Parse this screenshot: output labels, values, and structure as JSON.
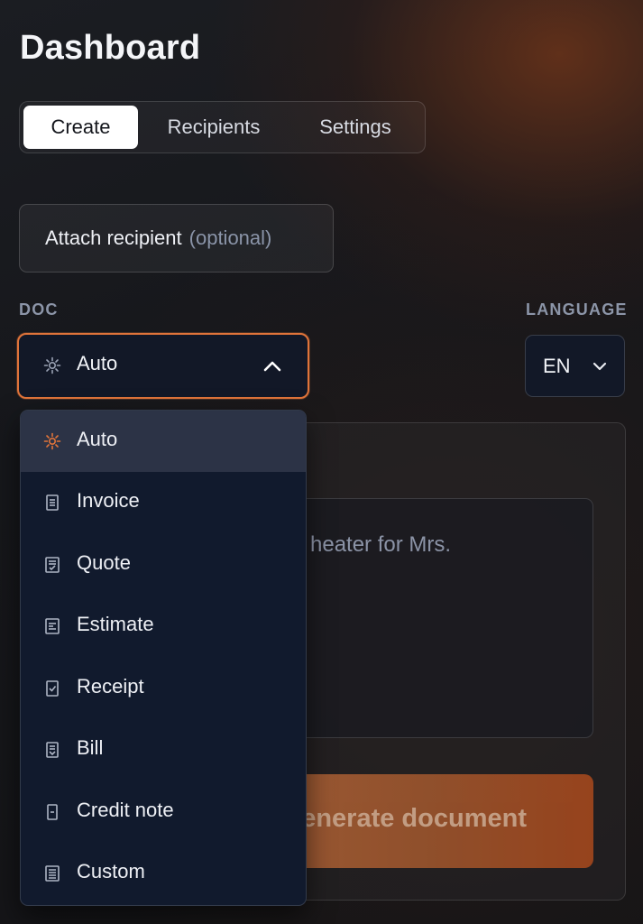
{
  "header": {
    "title": "Dashboard"
  },
  "tabs": [
    {
      "label": "Create",
      "active": true
    },
    {
      "label": "Recipients",
      "active": false
    },
    {
      "label": "Settings",
      "active": false
    }
  ],
  "attach": {
    "label": "Attach recipient",
    "optional": "(optional)"
  },
  "doc": {
    "label": "DOC",
    "selected": "Auto",
    "selected_icon": "sparkle-icon",
    "options": [
      {
        "label": "Auto",
        "icon": "sparkle-icon",
        "highlighted": true
      },
      {
        "label": "Invoice",
        "icon": "invoice-icon"
      },
      {
        "label": "Quote",
        "icon": "quote-icon"
      },
      {
        "label": "Estimate",
        "icon": "estimate-icon"
      },
      {
        "label": "Receipt",
        "icon": "receipt-icon"
      },
      {
        "label": "Bill",
        "icon": "bill-icon"
      },
      {
        "label": "Credit note",
        "icon": "credit-note-icon"
      },
      {
        "label": "Custom",
        "icon": "custom-icon"
      }
    ]
  },
  "language": {
    "label": "LANGUAGE",
    "selected": "EN"
  },
  "prompt": {
    "visible_text": "heater for Mrs."
  },
  "generate": {
    "visible_label": "enerate document"
  },
  "colors": {
    "accent": "#e0743a",
    "surface": "#111a2d",
    "highlight": "#2c3346"
  }
}
